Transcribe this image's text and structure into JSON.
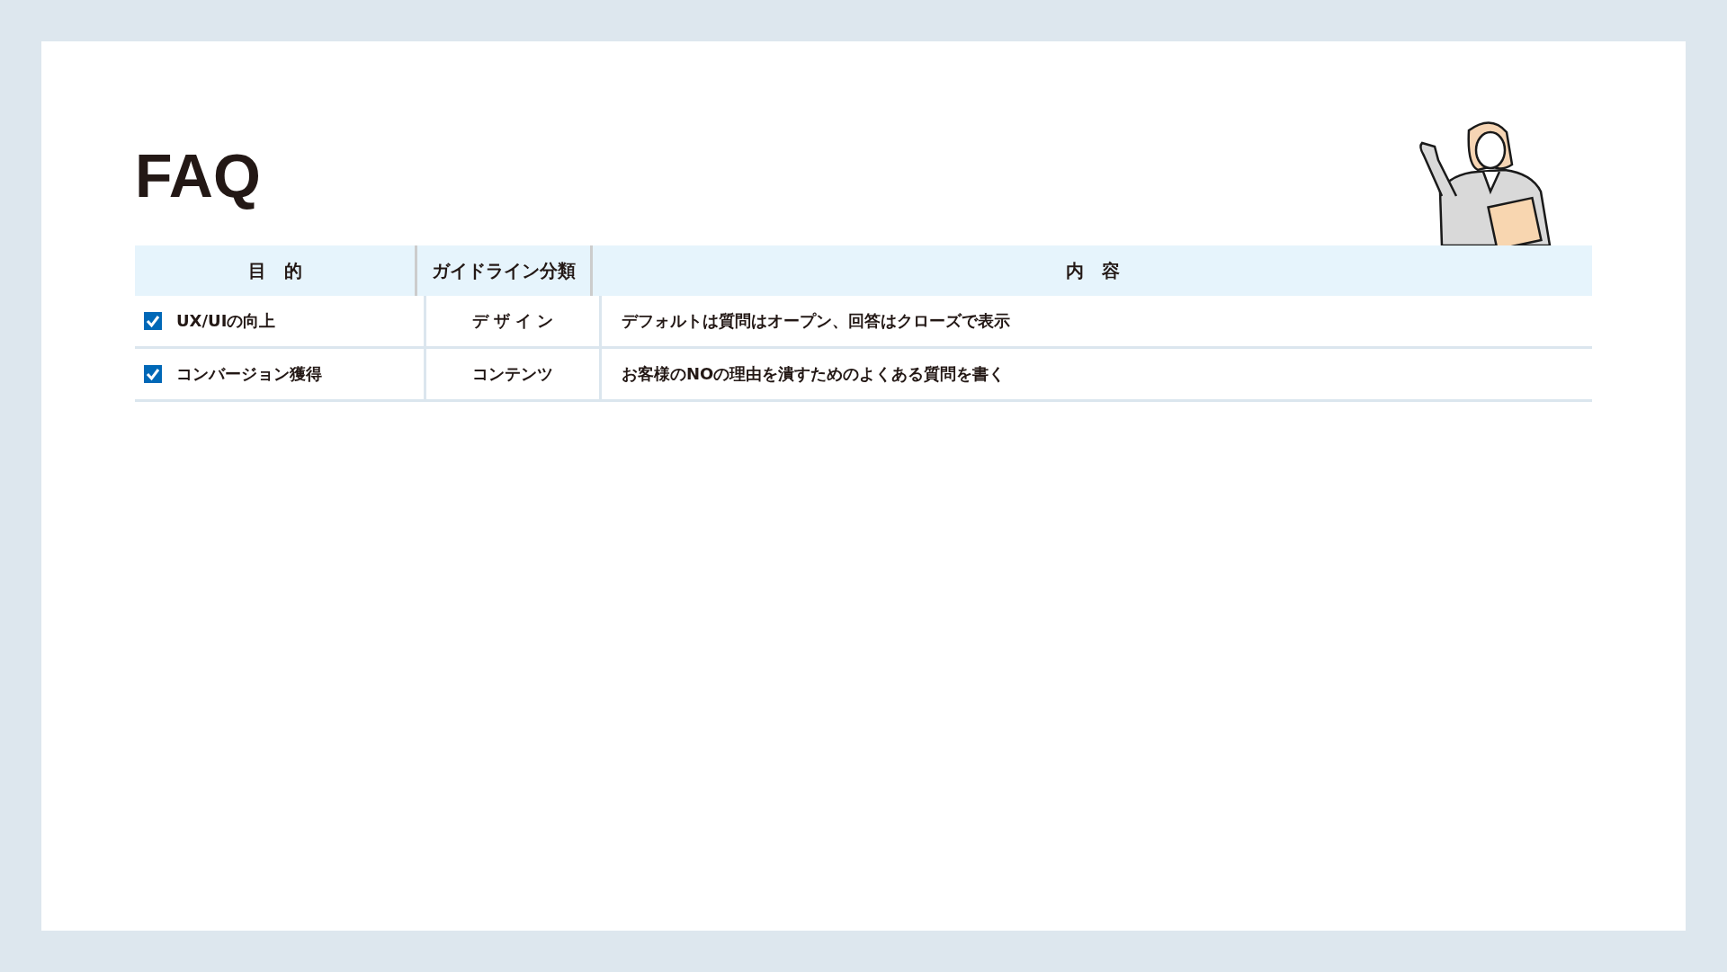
{
  "title": "FAQ",
  "table": {
    "columns": [
      "目　的",
      "ガイドライン分類",
      "内　容"
    ],
    "rows": [
      {
        "purpose": "UX/UIの向上",
        "checked": true,
        "category": "デ ザ イ ン",
        "content": "デフォルトは質問はオープン、回答はクローズで表示"
      },
      {
        "purpose": "コンバージョン獲得",
        "checked": true,
        "category": "コンテンツ",
        "content": "お客様のNOの理由を潰すためのよくある質問を書く"
      }
    ]
  }
}
